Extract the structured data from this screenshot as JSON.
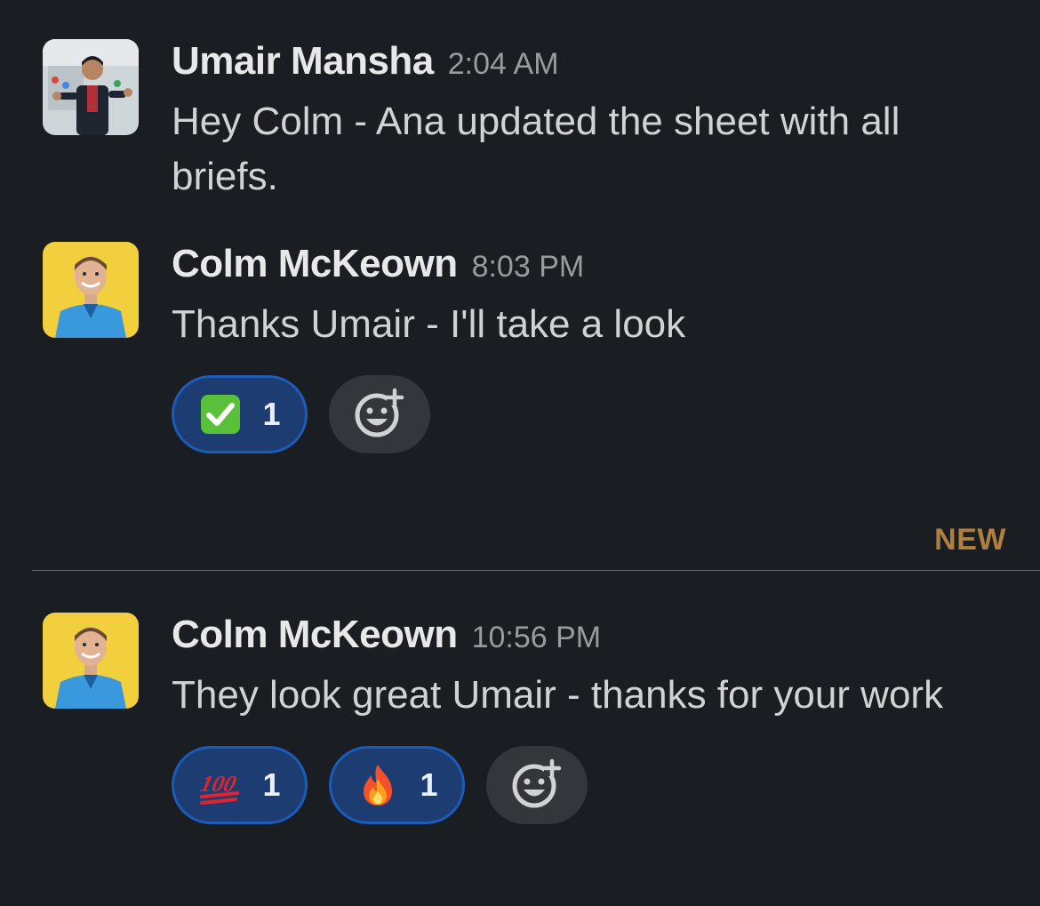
{
  "messages": [
    {
      "author": "Umair Mansha",
      "time": "2:04 AM",
      "text": "Hey Colm - Ana updated the sheet with all briefs.",
      "avatar": "umair-photo"
    },
    {
      "author": "Colm McKeown",
      "time": "8:03 PM",
      "text": "Thanks Umair - I'll take a look",
      "avatar": "colm-photo",
      "reactions": [
        {
          "emoji": "white-check-mark",
          "count": "1"
        }
      ]
    },
    {
      "author": "Colm McKeown",
      "time": "10:56 PM",
      "text": "They look great Umair - thanks for your work",
      "avatar": "colm-photo",
      "reactions": [
        {
          "emoji": "hundred-points",
          "count": "1"
        },
        {
          "emoji": "fire",
          "count": "1"
        }
      ]
    }
  ],
  "new_divider": {
    "label": "NEW",
    "color": "#b07f3c"
  },
  "colors": {
    "background": "#1a1d21",
    "reaction_active_bg": "#1d3d72",
    "reaction_active_border": "#1c5bb8",
    "add_reaction_bg": "#33363b"
  },
  "icons": {
    "add_reaction": "add-reaction-icon"
  }
}
